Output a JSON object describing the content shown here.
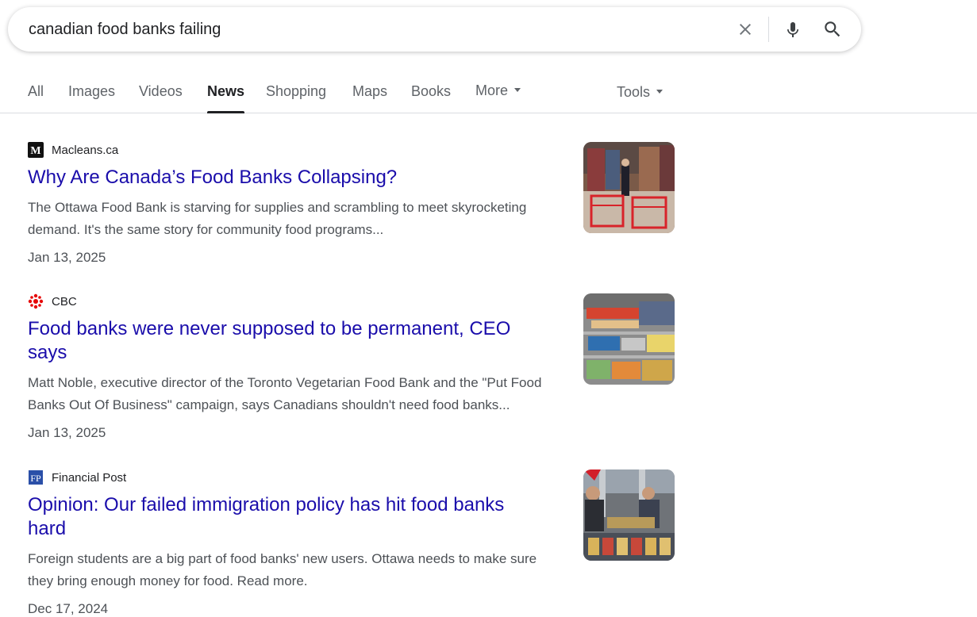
{
  "search": {
    "query": "canadian food banks failing"
  },
  "tabs": [
    {
      "label": "All"
    },
    {
      "label": "Images"
    },
    {
      "label": "Videos"
    },
    {
      "label": "News"
    },
    {
      "label": "Shopping"
    },
    {
      "label": "Maps"
    },
    {
      "label": "Books"
    },
    {
      "label": "More"
    }
  ],
  "tools_label": "Tools",
  "active_tab": "News",
  "results": [
    {
      "source": "Macleans.ca",
      "favicon_icon": "macleans-m-icon",
      "title": "Why Are Canada’s Food Banks Collapsing?",
      "snippet_line1": "The Ottawa Food Bank is starving for supplies and scrambling to meet skyrocketing",
      "snippet_line2": "demand. It's the same story for community food programs...",
      "date": "Jan 13, 2025"
    },
    {
      "source": "CBC",
      "favicon_icon": "cbc-gem-icon",
      "title_line1": "Food banks were never supposed to be permanent, CEO",
      "title_line2": "says",
      "snippet_line1": "Matt Noble, executive director of the Toronto Vegetarian Food Bank and the \"Put Food",
      "snippet_line2": "Banks Out Of Business\" campaign, says Canadians shouldn't need food banks...",
      "date": "Jan 13, 2025"
    },
    {
      "source": "Financial Post",
      "favicon_icon": "fp-icon",
      "title_line1": "Opinion: Our failed immigration policy has hit food banks",
      "title_line2": "hard",
      "snippet_line1": "Foreign students are a big part of food banks' new users. Ottawa needs to make sure",
      "snippet_line2": "they bring enough money for food. Read more.",
      "date": "Dec 17, 2024"
    }
  ],
  "colors": {
    "link": "#1a0dab",
    "snippet": "#4d5156",
    "tab_inactive": "#5f6368",
    "tab_active": "#202124",
    "cbc_red": "#e60505",
    "fp_blue": "#2a4fa8"
  }
}
